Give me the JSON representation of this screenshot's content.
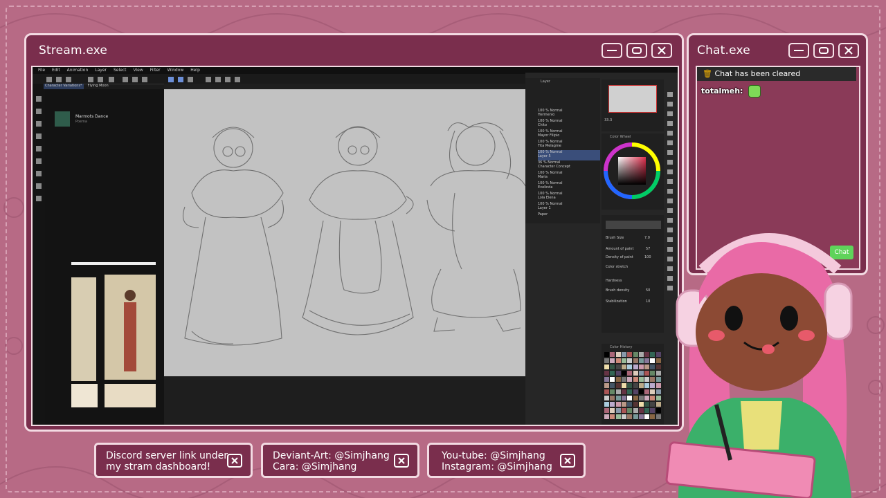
{
  "stream_window": {
    "title": "Stream.exe",
    "menu": [
      "File",
      "Edit",
      "Animation",
      "Layer",
      "Select",
      "View",
      "Filter",
      "Window",
      "Help"
    ],
    "tabs": [
      "Character Variations*",
      "Flying Moon"
    ],
    "material": {
      "name": "Marmots Dance",
      "sub": "Poema"
    },
    "layers": [
      {
        "mode": "100 % Normal",
        "name": "Hermenio"
      },
      {
        "mode": "100 % Normal",
        "name": "Chito"
      },
      {
        "mode": "100 % Normal",
        "name": "Mayor Filipio"
      },
      {
        "mode": "100 % Normal",
        "name": "Tita Melagme"
      },
      {
        "mode": "100 % Normal",
        "name": "Layer 5"
      },
      {
        "mode": "36 % Normal",
        "name": "Character Concept"
      },
      {
        "mode": "100 % Normal",
        "name": "Maria"
      },
      {
        "mode": "100 % Normal",
        "name": "Evelinda"
      },
      {
        "mode": "100 % Normal",
        "name": "Lola Elena"
      },
      {
        "mode": "100 % Normal",
        "name": "Layer 1"
      },
      {
        "mode": "",
        "name": "Paper"
      }
    ],
    "tool_property": {
      "brush_size_label": "Brush Size",
      "brush_size_value": "7.0",
      "amount_label": "Amount of paint",
      "amount_value": "57",
      "density_label": "Density of paint",
      "density_value": "100",
      "stretch_label": "Color stretch",
      "hardness_label": "Hardness",
      "brush_density_label": "Brush density",
      "brush_density_value": "50",
      "stabilization_label": "Stabilization",
      "stabilization_value": "10"
    },
    "navigator_zoom": "33.3",
    "color_panel_title": "Color Wheel",
    "color_history_title": "Color History"
  },
  "chat_window": {
    "title": "Chat.exe",
    "notice": "Chat has been cleared",
    "messages": [
      {
        "user": "totalmeh:",
        "emote": "green-emote"
      }
    ],
    "send_label": "Chat"
  },
  "banners": [
    {
      "line1": "Discord server link under",
      "line2": "my stram dashboard!"
    },
    {
      "line1": "Deviant-Art: @Simjhang",
      "line2": "Cara: @Simjhang"
    },
    {
      "line1": "You-tube: @Simjhang",
      "line2": "Instagram: @Simjhang"
    }
  ],
  "colors": {
    "background": "#b76a85",
    "window": "#7a2e4d",
    "border": "#f3dbe3",
    "accent_green": "#5fd35a"
  }
}
